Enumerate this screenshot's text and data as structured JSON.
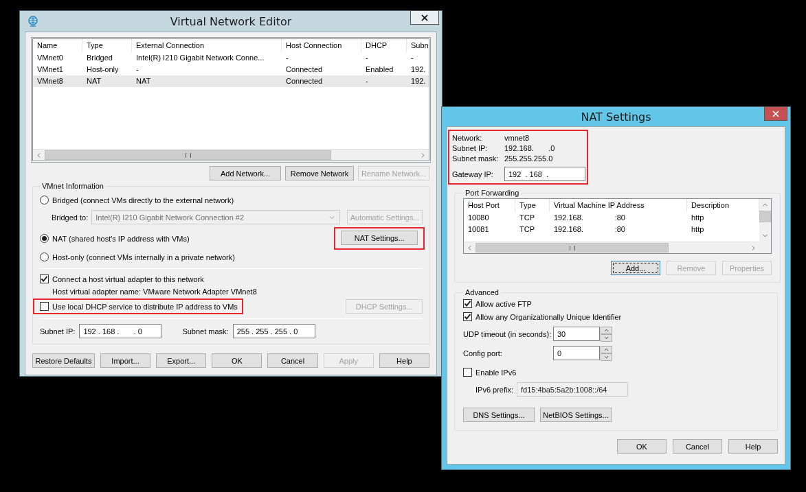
{
  "editor": {
    "title": "Virtual Network Editor",
    "table": {
      "columns": [
        "Name",
        "Type",
        "External Connection",
        "Host Connection",
        "DHCP",
        "Subn"
      ],
      "rows": [
        {
          "cells": [
            "VMnet0",
            "Bridged",
            "Intel(R) I210 Gigabit Network Conne...",
            "-",
            "-",
            "-"
          ],
          "selected": false
        },
        {
          "cells": [
            "VMnet1",
            "Host-only",
            "-",
            "Connected",
            "Enabled",
            "192."
          ],
          "selected": false
        },
        {
          "cells": [
            "VMnet8",
            "NAT",
            "NAT",
            "Connected",
            "-",
            "192."
          ],
          "selected": true
        }
      ]
    },
    "table_buttons": [
      {
        "label": "Add Network...",
        "disabled": false
      },
      {
        "label": "Remove Network",
        "disabled": false
      },
      {
        "label": "Rename Network...",
        "disabled": true
      }
    ],
    "vmnet_info": {
      "title": "VMnet Information",
      "bridged": {
        "label": "Bridged (connect VMs directly to the external network)",
        "selected": false
      },
      "bridged_to": {
        "label": "Bridged to:",
        "value": "Intel(R) I210 Gigabit Network Connection #2",
        "disabled": true
      },
      "automatic_settings": {
        "label": "Automatic Settings...",
        "disabled": true
      },
      "nat": {
        "label": "NAT (shared host's IP address with VMs)",
        "selected": true
      },
      "nat_settings": {
        "label": "NAT Settings...",
        "disabled": false,
        "highlighted": true
      },
      "host_only": {
        "label": "Host-only (connect VMs internally in a private network)",
        "selected": false
      },
      "connect_adapter": {
        "label": "Connect a host virtual adapter to this network",
        "checked": true
      },
      "adapter_name": "Host virtual adapter name: VMware Network Adapter VMnet8",
      "use_dhcp": {
        "label": "Use local DHCP service to distribute IP address to VMs",
        "checked": false,
        "highlighted": true
      },
      "dhcp_settings": {
        "label": "DHCP Settings...",
        "disabled": true
      },
      "subnet_ip": {
        "label": "Subnet IP:",
        "value": "192 . 168 .       . 0"
      },
      "subnet_mask": {
        "label": "Subnet mask:",
        "value": "255 . 255 . 255 . 0"
      }
    },
    "buttons": [
      {
        "label": "Restore Defaults",
        "disabled": false
      },
      {
        "label": "Import...",
        "disabled": false
      },
      {
        "label": "Export...",
        "disabled": false
      },
      {
        "label": "OK",
        "disabled": false
      },
      {
        "label": "Cancel",
        "disabled": false
      },
      {
        "label": "Apply",
        "disabled": true
      },
      {
        "label": "Help",
        "disabled": false
      }
    ]
  },
  "nat": {
    "title": "NAT Settings",
    "info": {
      "highlighted": true,
      "rows": [
        {
          "label": "Network:",
          "value": "vmnet8"
        },
        {
          "label": "Subnet IP:",
          "value": "192.168.       .0"
        },
        {
          "label": "Subnet mask:",
          "value": "255.255.255.0"
        }
      ],
      "gateway": {
        "label": "Gateway IP:",
        "value": "192  . 168  ."
      }
    },
    "port_forwarding": {
      "title": "Port Forwarding",
      "columns": [
        "Host Port",
        "Type",
        "Virtual Machine IP Address",
        "Description"
      ],
      "rows": [
        {
          "cells": [
            "10080",
            "TCP",
            "192.168.               :80",
            "http"
          ]
        },
        {
          "cells": [
            "10081",
            "TCP",
            "192.168.               :80",
            "http"
          ]
        }
      ],
      "buttons": [
        {
          "label": "Add...",
          "disabled": false,
          "focused": true
        },
        {
          "label": "Remove",
          "disabled": true,
          "focused": false
        },
        {
          "label": "Properties",
          "disabled": true,
          "focused": false
        }
      ]
    },
    "advanced": {
      "title": "Advanced",
      "allow_ftp": {
        "label": "Allow active FTP",
        "checked": true
      },
      "allow_oui": {
        "label": "Allow any Organizationally Unique Identifier",
        "checked": true
      },
      "udp_timeout": {
        "label": "UDP timeout (in seconds):",
        "value": "30"
      },
      "config_port": {
        "label": "Config port:",
        "value": "0"
      },
      "enable_ipv6": {
        "label": "Enable IPv6",
        "checked": false
      },
      "ipv6_prefix": {
        "label": "IPv6 prefix:",
        "value": "fd15:4ba5:5a2b:1008::/64",
        "disabled": true
      },
      "buttons": [
        {
          "label": "DNS Settings..."
        },
        {
          "label": "NetBIOS Settings..."
        }
      ]
    },
    "buttons": [
      {
        "label": "OK"
      },
      {
        "label": "Cancel"
      },
      {
        "label": "Help"
      }
    ]
  }
}
